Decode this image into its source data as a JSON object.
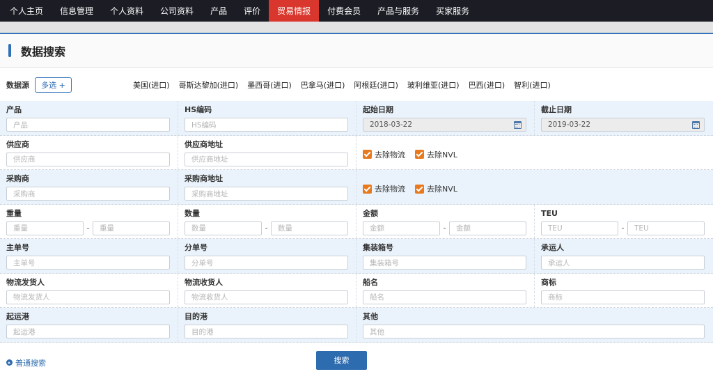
{
  "nav": {
    "items": [
      "个人主页",
      "信息管理",
      "个人资料",
      "公司资料",
      "产品",
      "评价",
      "贸易情报",
      "付费会员",
      "产品与服务",
      "买家服务"
    ],
    "active_index": 6
  },
  "page_title": "数据搜索",
  "source": {
    "label": "数据源",
    "multi_select_label": "多选 +",
    "countries": [
      "美国(进口)",
      "哥斯达黎加(进口)",
      "墨西哥(进口)",
      "巴拿马(进口)",
      "阿根廷(进口)",
      "玻利维亚(进口)",
      "巴西(进口)",
      "智利(进口)"
    ]
  },
  "fields": {
    "product": {
      "label": "产品",
      "placeholder": "产品"
    },
    "hs_code": {
      "label": "HS编码",
      "placeholder": "HS编码"
    },
    "start_date": {
      "label": "起始日期",
      "value": "2018-03-22"
    },
    "end_date": {
      "label": "截止日期",
      "value": "2019-03-22"
    },
    "supplier": {
      "label": "供应商",
      "placeholder": "供应商"
    },
    "supplier_address": {
      "label": "供应商地址",
      "placeholder": "供应商地址"
    },
    "buyer": {
      "label": "采购商",
      "placeholder": "采购商"
    },
    "buyer_address": {
      "label": "采购商地址",
      "placeholder": "采购商地址"
    },
    "remove_logistics": "去除物流",
    "remove_nvl": "去除NVL",
    "weight": {
      "label": "重量",
      "placeholder": "重量"
    },
    "quantity": {
      "label": "数量",
      "placeholder": "数量"
    },
    "amount": {
      "label": "金额",
      "placeholder": "金额"
    },
    "teu": {
      "label": "TEU",
      "placeholder": "TEU"
    },
    "range_sep": "-",
    "master_bill": {
      "label": "主单号",
      "placeholder": "主单号"
    },
    "house_bill": {
      "label": "分单号",
      "placeholder": "分单号"
    },
    "container_no": {
      "label": "集装箱号",
      "placeholder": "集装箱号"
    },
    "carrier": {
      "label": "承运人",
      "placeholder": "承运人"
    },
    "shipper": {
      "label": "物流发货人",
      "placeholder": "物流发货人"
    },
    "consignee": {
      "label": "物流收货人",
      "placeholder": "物流收货人"
    },
    "vessel": {
      "label": "船名",
      "placeholder": "船名"
    },
    "brand": {
      "label": "商标",
      "placeholder": "商标"
    },
    "origin_port": {
      "label": "起运港",
      "placeholder": "起运港"
    },
    "dest_port": {
      "label": "目的港",
      "placeholder": "目的港"
    },
    "other": {
      "label": "其他",
      "placeholder": "其他"
    }
  },
  "footer": {
    "basic_search_link": "普通搜索",
    "search_button": "搜索"
  },
  "colors": {
    "nav_bg": "#1b1c24",
    "nav_active": "#d9372d",
    "accent_blue": "#2e6cb0",
    "checkbox_orange": "#e7791f",
    "row_blue": "#eaf3fb"
  }
}
